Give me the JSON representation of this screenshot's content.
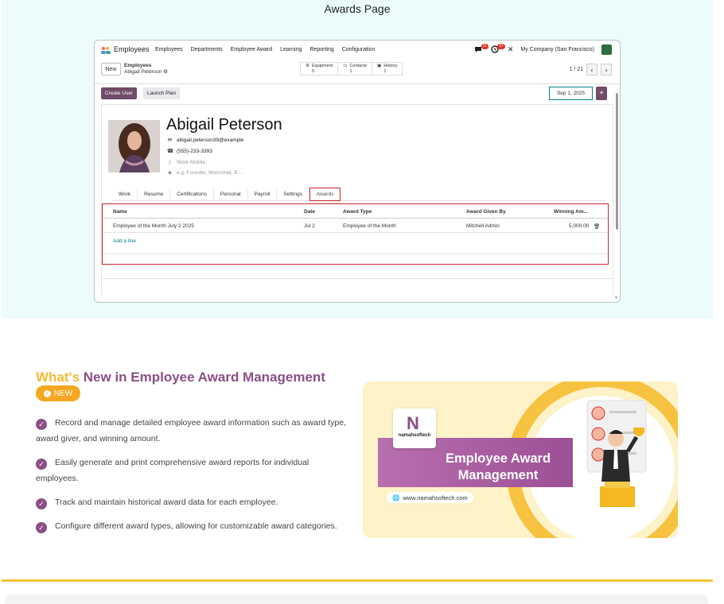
{
  "page": {
    "title": "Awards Page"
  },
  "navbar": {
    "app_name": "Employees",
    "menu": [
      "Employees",
      "Departments",
      "Employee Award",
      "Learning",
      "Reporting",
      "Configuration"
    ],
    "messages_count": "11",
    "activities_count": "37",
    "company": "My Company (San Francisco)"
  },
  "control_panel": {
    "new_label": "New",
    "breadcrumb_parent": "Employees",
    "breadcrumb_current": "Abigail Peterson",
    "smart_buttons": [
      {
        "label": "Equipment",
        "count": "0"
      },
      {
        "label": "Contacts",
        "count": "1"
      },
      {
        "label": "History",
        "count": "1"
      }
    ],
    "pager": "1 / 21"
  },
  "sheet_actions": {
    "create_user": "Create User",
    "launch_plan": "Launch Plan",
    "date": "Sep 1, 2025"
  },
  "employee": {
    "name": "Abigail Peterson",
    "email": "abigail.peterson39@example",
    "phone": "(555)-233-3393",
    "mobile_placeholder": "Work Mobile",
    "tags_placeholder": "e.g. Founder, Motorized, B..."
  },
  "tabs": [
    "Work",
    "Resume",
    "Certifications",
    "Personal",
    "Payroll",
    "Settings",
    "Awards"
  ],
  "awards_table": {
    "columns": [
      "Name",
      "Date",
      "Award Type",
      "Award Given By",
      "Winning Am..."
    ],
    "rows": [
      {
        "name": "Employee of the Month July 2 2025",
        "date": "Jul 2",
        "type": "Employee of the Month",
        "given_by": "Mitchell Admin",
        "amount": "5,000.00"
      }
    ],
    "add_line": "Add a line"
  },
  "features": {
    "title_highlight": "What's",
    "title_rest": " New in Employee Award Management",
    "badge": "NEW",
    "items": [
      "Record and manage detailed employee award information such as award type, award giver, and winning amount.",
      "Easily generate and print comprehensive award reports for individual employees.",
      "Track and maintain historical award data for each employee.",
      "Configure different award types, allowing for customizable award categories."
    ]
  },
  "banner": {
    "logo_text": "namahsoftech",
    "heading_line1": "Employee Award",
    "heading_line2": "Management",
    "url": "www.namahsoftech.com"
  },
  "colors": {
    "brand": "#714b67",
    "accent": "#f5b935",
    "purple": "#8b4f86",
    "highlight": "#d2232a"
  }
}
